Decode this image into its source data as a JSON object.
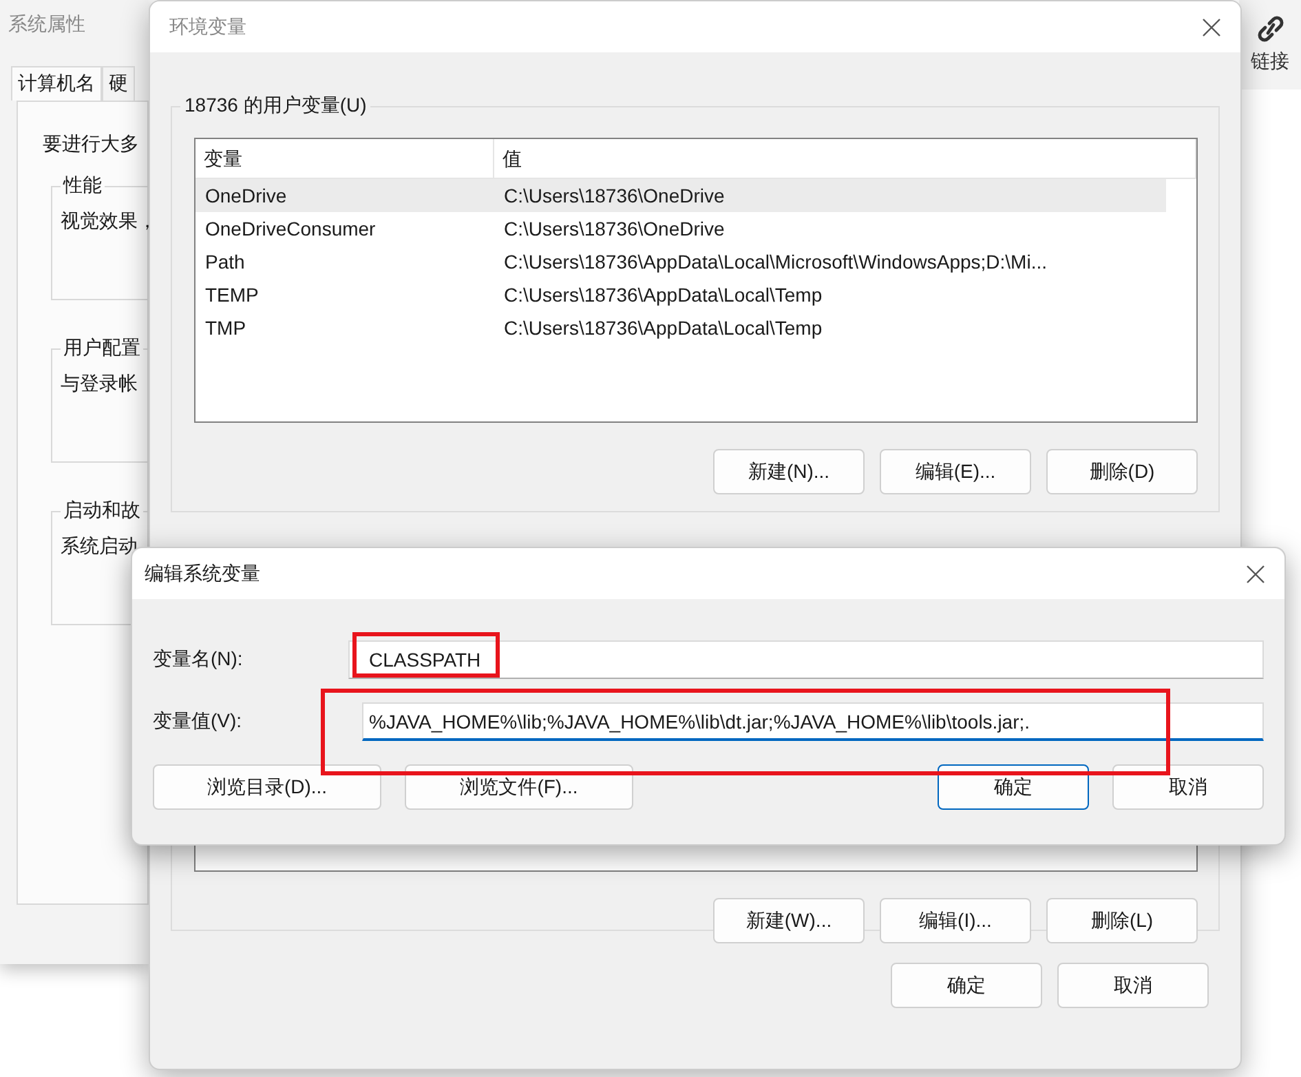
{
  "background_window": {
    "title": "系统属性",
    "tabs": [
      {
        "label": "计算机名"
      },
      {
        "label": "硬"
      }
    ],
    "intro": "要进行大多",
    "groups": [
      {
        "title": "性能",
        "text": "视觉效果，"
      },
      {
        "title": "用户配置",
        "text": "与登录帐"
      },
      {
        "title": "启动和故",
        "text": "系统启动"
      }
    ]
  },
  "side_panel": {
    "label": "链接"
  },
  "env_window": {
    "title": "环境变量",
    "user_group": {
      "title": "18736 的用户变量(U)",
      "columns": [
        "变量",
        "值"
      ],
      "rows": [
        {
          "name": "OneDrive",
          "value": "C:\\Users\\18736\\OneDrive",
          "selected": true
        },
        {
          "name": "OneDriveConsumer",
          "value": "C:\\Users\\18736\\OneDrive",
          "selected": false
        },
        {
          "name": "Path",
          "value": "C:\\Users\\18736\\AppData\\Local\\Microsoft\\WindowsApps;D:\\Mi...",
          "selected": false
        },
        {
          "name": "TEMP",
          "value": "C:\\Users\\18736\\AppData\\Local\\Temp",
          "selected": false
        },
        {
          "name": "TMP",
          "value": "C:\\Users\\18736\\AppData\\Local\\Temp",
          "selected": false
        }
      ],
      "buttons": [
        "新建(N)...",
        "编辑(E)...",
        "删除(D)"
      ]
    },
    "system_group": {
      "buttons": [
        "新建(W)...",
        "编辑(I)...",
        "删除(L)"
      ]
    },
    "buttons": [
      "确定",
      "取消"
    ]
  },
  "edit_dialog": {
    "title": "编辑系统变量",
    "fields": [
      {
        "label": "变量名(N):",
        "value": "CLASSPATH",
        "focused": false,
        "highlighted": true
      },
      {
        "label": "变量值(V):",
        "value": "%JAVA_HOME%\\lib;%JAVA_HOME%\\lib\\dt.jar;%JAVA_HOME%\\lib\\tools.jar;.",
        "focused": true,
        "highlighted": true
      }
    ],
    "buttons": [
      {
        "label": "浏览目录(D)...",
        "default": false
      },
      {
        "label": "浏览文件(F)...",
        "default": false
      },
      {
        "label": "确定",
        "default": true
      },
      {
        "label": "取消",
        "default": false
      }
    ]
  }
}
